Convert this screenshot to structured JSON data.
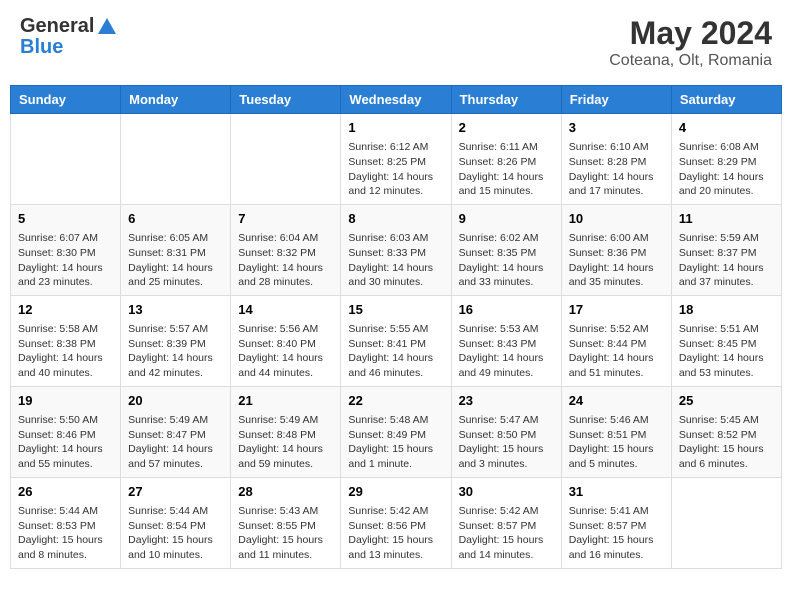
{
  "header": {
    "logo_general": "General",
    "logo_blue": "Blue",
    "month_year": "May 2024",
    "location": "Coteana, Olt, Romania"
  },
  "columns": [
    "Sunday",
    "Monday",
    "Tuesday",
    "Wednesday",
    "Thursday",
    "Friday",
    "Saturday"
  ],
  "weeks": [
    [
      {
        "day": "",
        "info": ""
      },
      {
        "day": "",
        "info": ""
      },
      {
        "day": "",
        "info": ""
      },
      {
        "day": "1",
        "info": "Sunrise: 6:12 AM\nSunset: 8:25 PM\nDaylight: 14 hours and 12 minutes."
      },
      {
        "day": "2",
        "info": "Sunrise: 6:11 AM\nSunset: 8:26 PM\nDaylight: 14 hours and 15 minutes."
      },
      {
        "day": "3",
        "info": "Sunrise: 6:10 AM\nSunset: 8:28 PM\nDaylight: 14 hours and 17 minutes."
      },
      {
        "day": "4",
        "info": "Sunrise: 6:08 AM\nSunset: 8:29 PM\nDaylight: 14 hours and 20 minutes."
      }
    ],
    [
      {
        "day": "5",
        "info": "Sunrise: 6:07 AM\nSunset: 8:30 PM\nDaylight: 14 hours and 23 minutes."
      },
      {
        "day": "6",
        "info": "Sunrise: 6:05 AM\nSunset: 8:31 PM\nDaylight: 14 hours and 25 minutes."
      },
      {
        "day": "7",
        "info": "Sunrise: 6:04 AM\nSunset: 8:32 PM\nDaylight: 14 hours and 28 minutes."
      },
      {
        "day": "8",
        "info": "Sunrise: 6:03 AM\nSunset: 8:33 PM\nDaylight: 14 hours and 30 minutes."
      },
      {
        "day": "9",
        "info": "Sunrise: 6:02 AM\nSunset: 8:35 PM\nDaylight: 14 hours and 33 minutes."
      },
      {
        "day": "10",
        "info": "Sunrise: 6:00 AM\nSunset: 8:36 PM\nDaylight: 14 hours and 35 minutes."
      },
      {
        "day": "11",
        "info": "Sunrise: 5:59 AM\nSunset: 8:37 PM\nDaylight: 14 hours and 37 minutes."
      }
    ],
    [
      {
        "day": "12",
        "info": "Sunrise: 5:58 AM\nSunset: 8:38 PM\nDaylight: 14 hours and 40 minutes."
      },
      {
        "day": "13",
        "info": "Sunrise: 5:57 AM\nSunset: 8:39 PM\nDaylight: 14 hours and 42 minutes."
      },
      {
        "day": "14",
        "info": "Sunrise: 5:56 AM\nSunset: 8:40 PM\nDaylight: 14 hours and 44 minutes."
      },
      {
        "day": "15",
        "info": "Sunrise: 5:55 AM\nSunset: 8:41 PM\nDaylight: 14 hours and 46 minutes."
      },
      {
        "day": "16",
        "info": "Sunrise: 5:53 AM\nSunset: 8:43 PM\nDaylight: 14 hours and 49 minutes."
      },
      {
        "day": "17",
        "info": "Sunrise: 5:52 AM\nSunset: 8:44 PM\nDaylight: 14 hours and 51 minutes."
      },
      {
        "day": "18",
        "info": "Sunrise: 5:51 AM\nSunset: 8:45 PM\nDaylight: 14 hours and 53 minutes."
      }
    ],
    [
      {
        "day": "19",
        "info": "Sunrise: 5:50 AM\nSunset: 8:46 PM\nDaylight: 14 hours and 55 minutes."
      },
      {
        "day": "20",
        "info": "Sunrise: 5:49 AM\nSunset: 8:47 PM\nDaylight: 14 hours and 57 minutes."
      },
      {
        "day": "21",
        "info": "Sunrise: 5:49 AM\nSunset: 8:48 PM\nDaylight: 14 hours and 59 minutes."
      },
      {
        "day": "22",
        "info": "Sunrise: 5:48 AM\nSunset: 8:49 PM\nDaylight: 15 hours and 1 minute."
      },
      {
        "day": "23",
        "info": "Sunrise: 5:47 AM\nSunset: 8:50 PM\nDaylight: 15 hours and 3 minutes."
      },
      {
        "day": "24",
        "info": "Sunrise: 5:46 AM\nSunset: 8:51 PM\nDaylight: 15 hours and 5 minutes."
      },
      {
        "day": "25",
        "info": "Sunrise: 5:45 AM\nSunset: 8:52 PM\nDaylight: 15 hours and 6 minutes."
      }
    ],
    [
      {
        "day": "26",
        "info": "Sunrise: 5:44 AM\nSunset: 8:53 PM\nDaylight: 15 hours and 8 minutes."
      },
      {
        "day": "27",
        "info": "Sunrise: 5:44 AM\nSunset: 8:54 PM\nDaylight: 15 hours and 10 minutes."
      },
      {
        "day": "28",
        "info": "Sunrise: 5:43 AM\nSunset: 8:55 PM\nDaylight: 15 hours and 11 minutes."
      },
      {
        "day": "29",
        "info": "Sunrise: 5:42 AM\nSunset: 8:56 PM\nDaylight: 15 hours and 13 minutes."
      },
      {
        "day": "30",
        "info": "Sunrise: 5:42 AM\nSunset: 8:57 PM\nDaylight: 15 hours and 14 minutes."
      },
      {
        "day": "31",
        "info": "Sunrise: 5:41 AM\nSunset: 8:57 PM\nDaylight: 15 hours and 16 minutes."
      },
      {
        "day": "",
        "info": ""
      }
    ]
  ]
}
